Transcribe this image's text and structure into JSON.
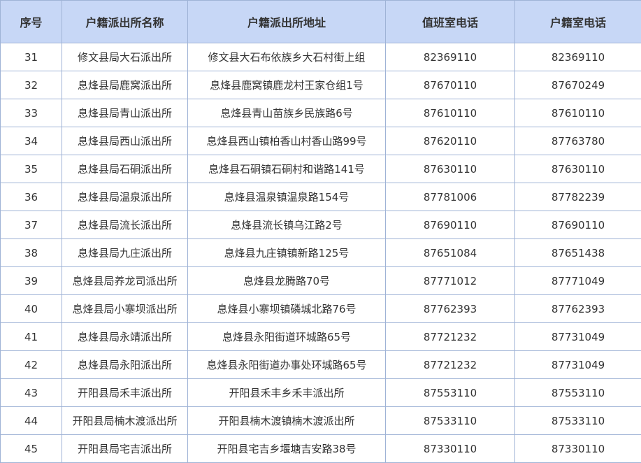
{
  "headers": [
    "序号",
    "户籍派出所名称",
    "户籍派出所地址",
    "值班室电话",
    "户籍室电话"
  ],
  "rows": [
    [
      "31",
      "修文县局大石派出所",
      "修文县大石布依族乡大石村街上组",
      "82369110",
      "82369110"
    ],
    [
      "32",
      "息烽县局鹿窝派出所",
      "息烽县鹿窝镇鹿龙村王家仓组1号",
      "87670110",
      "87670249"
    ],
    [
      "33",
      "息烽县局青山派出所",
      "息烽县青山苗族乡民族路6号",
      "87610110",
      "87610110"
    ],
    [
      "34",
      "息烽县局西山派出所",
      "息烽县西山镇柏香山村香山路99号",
      "87620110",
      "87763780"
    ],
    [
      "35",
      "息烽县局石硐派出所",
      "息烽县石硐镇石硐村和谐路141号",
      "87630110",
      "87630110"
    ],
    [
      "36",
      "息烽县局温泉派出所",
      "息烽县温泉镇温泉路154号",
      "87781006",
      "87782239"
    ],
    [
      "37",
      "息烽县局流长派出所",
      "息烽县流长镇乌江路2号",
      "87690110",
      "87690110"
    ],
    [
      "38",
      "息烽县局九庄派出所",
      "息烽县九庄镇镇新路125号",
      "87651084",
      "87651438"
    ],
    [
      "39",
      "息烽县局养龙司派出所",
      "息烽县龙腾路70号",
      "87771012",
      "87771049"
    ],
    [
      "40",
      "息烽县局小寨坝派出所",
      "息烽县小寨坝镇磷城北路76号",
      "87762393",
      "87762393"
    ],
    [
      "41",
      "息烽县局永靖派出所",
      "息烽县永阳街道环城路65号",
      "87721232",
      "87731049"
    ],
    [
      "42",
      "息烽县局永阳派出所",
      "息烽县永阳街道办事处环城路65号",
      "87721232",
      "87731049"
    ],
    [
      "43",
      "开阳县局禾丰派出所",
      "开阳县禾丰乡禾丰派出所",
      "87553110",
      "87553110"
    ],
    [
      "44",
      "开阳县局楠木渡派出所",
      "开阳县楠木渡镇楠木渡派出所",
      "87533110",
      "87533110"
    ],
    [
      "45",
      "开阳县局宅吉派出所",
      "开阳县宅吉乡堰塘吉安路38号",
      "87330110",
      "87330110"
    ]
  ]
}
